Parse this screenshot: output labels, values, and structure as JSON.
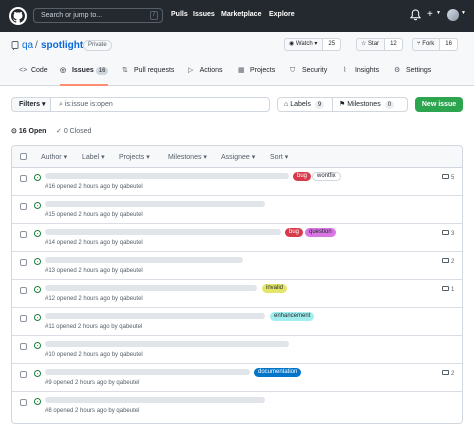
{
  "header": {
    "search_placeholder": "Search or jump to...",
    "slash_key": "/",
    "nav": [
      "Pulls",
      "Issues",
      "Marketplace",
      "Explore"
    ],
    "plus": "+"
  },
  "repo": {
    "owner": "qa",
    "separator": "/",
    "name": "spotlight",
    "visibility": "Private",
    "watch_label": "Watch",
    "watch_count": "25",
    "star_label": "Star",
    "star_count": "12",
    "fork_label": "Fork",
    "fork_count": "16"
  },
  "tabs": [
    {
      "label": "Code",
      "icon": "code-icon"
    },
    {
      "label": "Issues",
      "icon": "issue-icon",
      "count": "16"
    },
    {
      "label": "Pull requests",
      "icon": "pull-request-icon"
    },
    {
      "label": "Actions",
      "icon": "play-icon"
    },
    {
      "label": "Projects",
      "icon": "table-icon"
    },
    {
      "label": "Security",
      "icon": "shield-icon"
    },
    {
      "label": "Insights",
      "icon": "graph-icon"
    },
    {
      "label": "Settings",
      "icon": "gear-icon"
    }
  ],
  "toolbar": {
    "filters_label": "Filters",
    "search_value": "is:issue is:open",
    "labels_label": "Labels",
    "labels_count": "9",
    "milestones_label": "Milestones",
    "milestones_count": "0",
    "new_issue_label": "New issue"
  },
  "states": {
    "open_label": "16 Open",
    "closed_label": "0 Closed"
  },
  "table_header": [
    "Author",
    "Label",
    "Projects",
    "Milestones",
    "Assignee",
    "Sort"
  ],
  "issues": [
    {
      "meta": "#16 opened 2 hours ago by qabeutel",
      "labels": [
        {
          "text": "bug",
          "color": "#d73a4a"
        },
        {
          "text": "wontfix",
          "color": "#ffffff"
        }
      ],
      "comments": "5"
    },
    {
      "meta": "#15 opened 2 hours ago by qabeutel",
      "labels": [],
      "comments": ""
    },
    {
      "meta": "#14 opened 2 hours ago by qabeutel",
      "labels": [
        {
          "text": "bug",
          "color": "#d73a4a"
        },
        {
          "text": "question",
          "color": "#d876e3"
        }
      ],
      "comments": "3"
    },
    {
      "meta": "#13 opened 2 hours ago by qabeutel",
      "labels": [],
      "comments": "2"
    },
    {
      "meta": "#12 opened 2 hours ago by qabeutel",
      "labels": [
        {
          "text": "invalid",
          "color": "#e4e669"
        }
      ],
      "comments": "1"
    },
    {
      "meta": "#11 opened 2 hours ago by qabeutel",
      "labels": [
        {
          "text": "enhancement",
          "color": "#a2eeef"
        }
      ],
      "comments": ""
    },
    {
      "meta": "#10 opened 2 hours ago by qabeutel",
      "labels": [],
      "comments": ""
    },
    {
      "meta": "#9 opened 2 hours ago by qabeutel",
      "labels": [
        {
          "text": "documentation",
          "color": "#0075ca"
        }
      ],
      "comments": "2"
    },
    {
      "meta": "#8 opened 2 hours ago by qabeutel",
      "labels": [],
      "comments": ""
    }
  ],
  "colors": {
    "header_bg": "#24292f",
    "accent_blue": "#0969da",
    "success_green": "#2da44e",
    "tab_underline": "#fd8c73"
  }
}
